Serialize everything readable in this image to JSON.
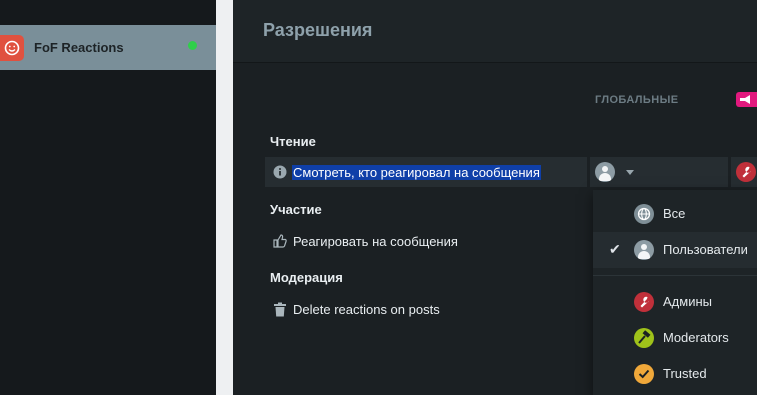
{
  "sidebar": {
    "extension": {
      "name": "FoF Reactions",
      "enabled": true,
      "status_color": "#2fcf4a"
    }
  },
  "header": {
    "title": "Разрешения"
  },
  "columns": {
    "global": "ГЛОБАЛЬНЫЕ"
  },
  "sections": [
    {
      "title": "Чтение",
      "permissions": [
        {
          "label": "Смотреть, кто реагировал на сообщения",
          "icon": "info-circle-icon",
          "selected_text": true
        }
      ]
    },
    {
      "title": "Участие",
      "permissions": [
        {
          "label": "Реагировать на сообщения",
          "icon": "thumbs-up-icon"
        }
      ]
    },
    {
      "title": "Модерация",
      "permissions": [
        {
          "label": "Delete reactions on posts",
          "icon": "trash-icon"
        }
      ]
    }
  ],
  "dropdown": {
    "items": [
      {
        "label": "Все",
        "icon": "globe-icon",
        "checked": false,
        "color": "#7f8f97"
      },
      {
        "label": "Пользователи",
        "icon": "user-icon",
        "checked": true,
        "color": "#8d9ca4"
      },
      {
        "label": "Админы",
        "icon": "wrench-icon",
        "checked": false,
        "color": "#c0303a"
      },
      {
        "label": "Moderators",
        "icon": "hammer-icon",
        "checked": false,
        "color": "#9fc21a"
      },
      {
        "label": "Trusted",
        "icon": "check-icon",
        "checked": false,
        "color": "#f0a83a"
      }
    ]
  },
  "colors": {
    "accent_badge": "#e2197e",
    "selection": "#0f3fa8"
  }
}
